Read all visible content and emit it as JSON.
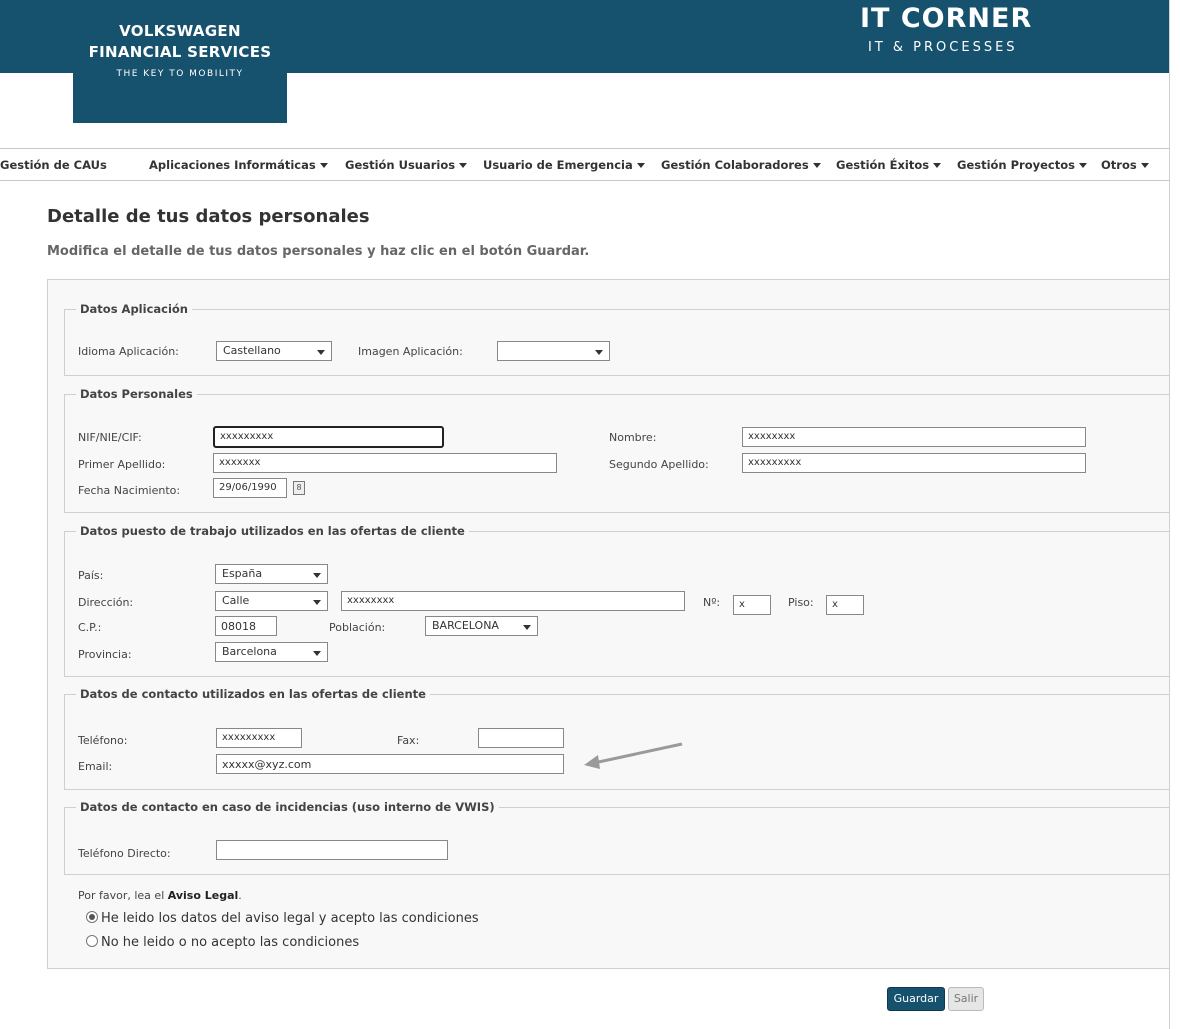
{
  "header": {
    "brand_line1": "VOLKSWAGEN",
    "brand_line2": "FINANCIAL SERVICES",
    "brand_tagline": "THE KEY TO MOBILITY",
    "site_title": "IT CORNER",
    "site_subtitle": "IT & PROCESSES",
    "brand_color": "#16526e"
  },
  "nav": {
    "items": [
      {
        "label": "Gestión de CAUs",
        "dropdown": false
      },
      {
        "label": "Aplicaciones Informáticas",
        "dropdown": true
      },
      {
        "label": "Gestión Usuarios",
        "dropdown": true
      },
      {
        "label": "Usuario de Emergencia",
        "dropdown": true
      },
      {
        "label": "Gestión Colaboradores",
        "dropdown": true
      },
      {
        "label": "Gestión Éxitos",
        "dropdown": true
      },
      {
        "label": "Gestión Proyectos",
        "dropdown": true
      },
      {
        "label": "Otros",
        "dropdown": true
      }
    ]
  },
  "page": {
    "title": "Detalle de tus datos personales",
    "subtitle": "Modifica el detalle de tus datos personales y haz clic en el botón Guardar."
  },
  "app_data": {
    "legend": "Datos Aplicación",
    "language_label": "Idioma Aplicación:",
    "language_value": "Castellano",
    "image_label": "Imagen Aplicación:",
    "image_value": ""
  },
  "personal": {
    "legend": "Datos Personales",
    "nif_label": "NIF/NIE/CIF:",
    "nif_value": "xxxxxxxxx",
    "name_label": "Nombre:",
    "name_value": "xxxxxxxx",
    "surname1_label": "Primer Apellido:",
    "surname1_value": "xxxxxxx",
    "surname2_label": "Segundo Apellido:",
    "surname2_value": "xxxxxxxxx",
    "birth_label": "Fecha Nacimiento:",
    "birth_value": "29/06/1990"
  },
  "workplace": {
    "legend": "Datos puesto de trabajo utilizados en las ofertas de cliente",
    "country_label": "País:",
    "country_value": "España",
    "address_label": "Dirección:",
    "street_type_value": "Calle",
    "street_value": "xxxxxxxx",
    "number_label": "Nº:",
    "number_value": "x",
    "floor_label": "Piso:",
    "floor_value": "x",
    "zip_label": "C.P.:",
    "zip_value": "08018",
    "city_label": "Población:",
    "city_value": "BARCELONA",
    "province_label": "Provincia:",
    "province_value": "Barcelona"
  },
  "contact": {
    "legend": "Datos de contacto utilizados en las ofertas de cliente",
    "phone_label": "Teléfono:",
    "phone_value": "xxxxxxxxx",
    "fax_label": "Fax:",
    "fax_value": "",
    "email_label": "Email:",
    "email_value": "xxxxx@xyz.com"
  },
  "incidents": {
    "legend": "Datos de contacto en caso de incidencias (uso interno de VWIS)",
    "direct_phone_label": "Teléfono Directo:",
    "direct_phone_value": ""
  },
  "legal": {
    "prefix": "Por favor, lea el",
    "link": "Aviso Legal",
    "suffix": ".",
    "accept_label": "He leido los datos del aviso legal y acepto las condiciones",
    "reject_label": "No he leido o no acepto las condiciones",
    "selected": "accept"
  },
  "buttons": {
    "save": "Guardar",
    "exit": "Salir"
  }
}
